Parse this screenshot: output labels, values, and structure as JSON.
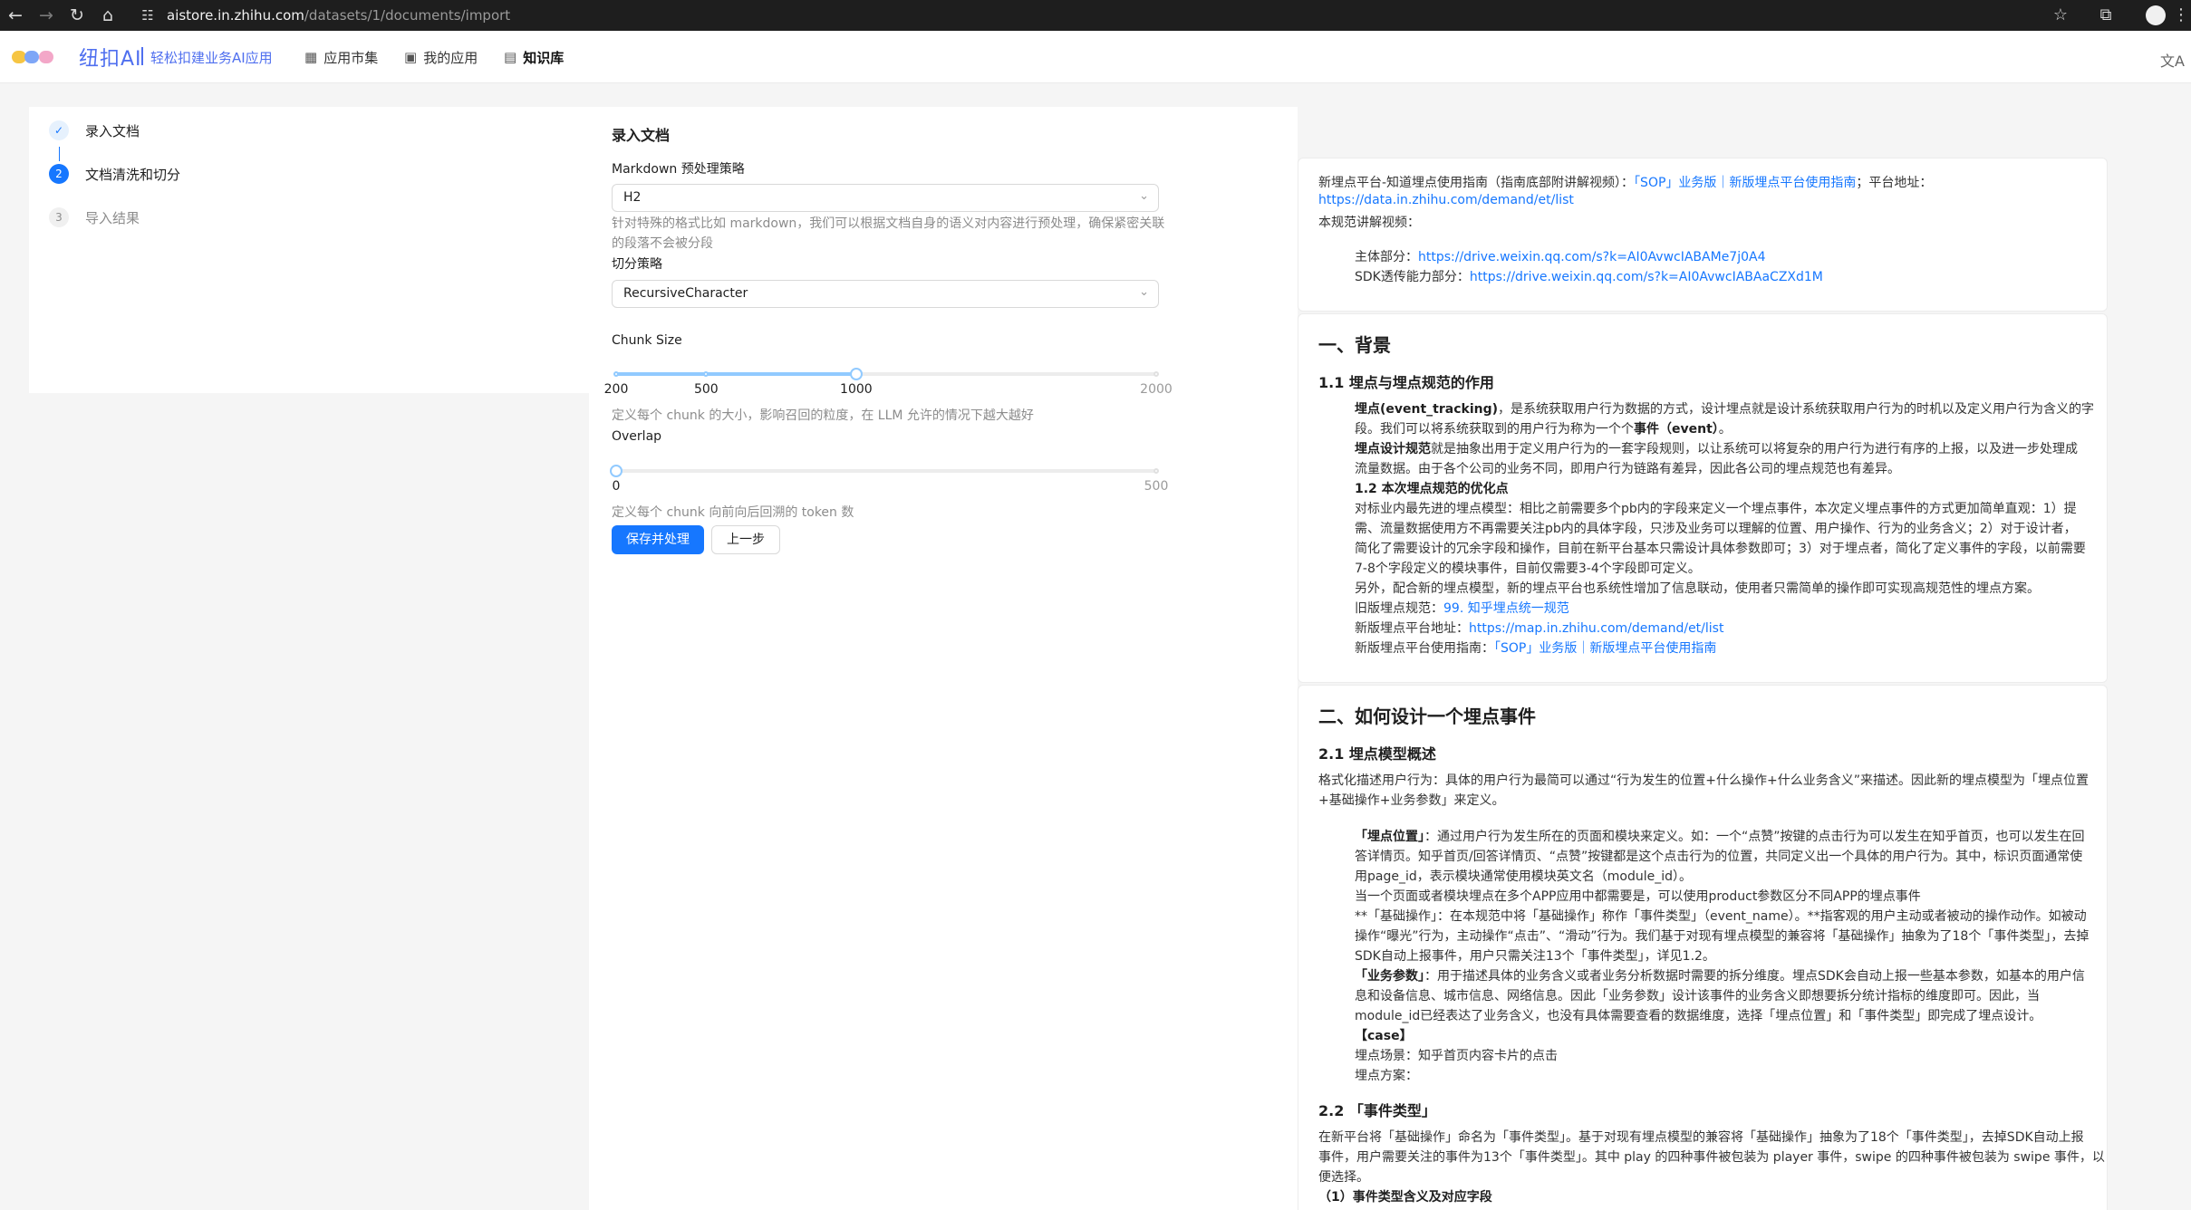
{
  "browser": {
    "url_host": "aistore.in.zhihu.com",
    "url_path": "/datasets/1/documents/import"
  },
  "header": {
    "brand": "纽扣AI",
    "tagline": "轻松扣建业务AI应用",
    "nav": [
      {
        "label": "应用市集",
        "icon": "grid-icon"
      },
      {
        "label": "我的应用",
        "icon": "apps-icon"
      },
      {
        "label": "知识库",
        "icon": "book-icon"
      }
    ],
    "logo_colors": [
      "#f6c543",
      "#7ea6f7",
      "#f3a7c8"
    ]
  },
  "steps": [
    {
      "index": "✓",
      "label": "录入文档",
      "state": "done"
    },
    {
      "index": "2",
      "label": "文档清洗和切分",
      "state": "active"
    },
    {
      "index": "3",
      "label": "导入结果",
      "state": "pending"
    }
  ],
  "form": {
    "title": "录入文档",
    "markdown_label": "Markdown 预处理策略",
    "markdown_value": "H2",
    "markdown_help_1": "针对特殊的格式比如 markdown，我们可以根据文档自身的语义对内容进行预处理，确保紧密关联",
    "markdown_help_2": "的段落不会被分段",
    "split_label": "切分策略",
    "split_value": "RecursiveCharacter",
    "chunk_label": "Chunk Size",
    "chunk_value": 1000,
    "chunk_min": 200,
    "chunk_max": 2000,
    "chunk_marks": [
      "200",
      "500",
      "1000",
      "2000"
    ],
    "chunk_help": "定义每个 chunk 的大小，影响召回的粒度，在 LLM 允许的情况下越大越好",
    "overlap_label": "Overlap",
    "overlap_value": 0,
    "overlap_min": 0,
    "overlap_max": 500,
    "overlap_marks": [
      "0",
      "500"
    ],
    "overlap_help": "定义每个 chunk 向前向后回溯的 token 数",
    "save_button": "保存并处理",
    "prev_button": "上一步"
  },
  "preview": {
    "c1": {
      "l1a": "新埋点平台-知道埋点使用指南（指南底部附讲解视频）：",
      "l1b": "「SOP」业务版｜新版埋点平台使用指南",
      "l1c": "；平台地址：",
      "l2": "https://data.in.zhihu.com/demand/et/list",
      "l3": "本规范讲解视频：",
      "l4a": "主体部分：",
      "l4b": "https://drive.weixin.qq.com/s?k=AI0AvwcIABAMe7j0A4",
      "l5a": "SDK透传能力部分：",
      "l5b": "https://drive.weixin.qq.com/s?k=AI0AvwcIABAaCZXd1M"
    },
    "c2": {
      "h1": "一、背景",
      "h2": "1.1 埋点与埋点规范的作用",
      "p1a": "埋点(event_tracking)",
      "p1b": "，是系统获取用户行为数据的方式，设计埋点就是设计系统获取用户行为的时机以及定义用户行为含义的字",
      "p2a": "段。我们可以将系统获取到的用户行为称为一个个",
      "p2b": "事件（event）",
      "p2c": "。",
      "p3a": "埋点设计规范",
      "p3b": "就是抽象出用于定义用户行为的一套字段规则，以让系统可以将复杂的用户行为进行有序的上报，以及进一步处理成",
      "p4": "流量数据。由于各个公司的业务不同，即用户行为链路有差异，因此各公司的埋点规范也有差异。",
      "h3": "1.2 本次埋点规范的优化点",
      "p5": "对标业内最先进的埋点模型：相比之前需要多个pb内的字段来定义一个埋点事件，本次定义埋点事件的方式更加简单直观：1）提",
      "p6": "需、流量数据使用方不再需要关注pb内的具体字段，只涉及业务可以理解的位置、用户操作、行为的业务含义；2）对于设计者，",
      "p7": "简化了需要设计的冗余字段和操作，目前在新平台基本只需设计具体参数即可；3）对于埋点者，简化了定义事件的字段，以前需要",
      "p8": "7-8个字段定义的模块事件，目前仅需要3-4个字段即可定义。",
      "p9": "另外，配合新的埋点模型，新的埋点平台也系统性增加了信息联动，使用者只需简单的操作即可实现高规范性的埋点方案。",
      "p10a": "旧版埋点规范：",
      "p10b": "99. 知乎埋点统一规范",
      "p11a": "新版埋点平台地址：",
      "p11b": "https://map.in.zhihu.com/demand/et/list",
      "p12a": "新版埋点平台使用指南：",
      "p12b": "「SOP」业务版｜新版埋点平台使用指南"
    },
    "c3": {
      "h1": "二、如何设计一个埋点事件",
      "h2": "2.1 埋点模型概述",
      "p1": "格式化描述用户行为：具体的用户行为最简可以通过“行为发生的位置+什么操作+什么业务含义”来描述。因此新的埋点模型为「埋点位置",
      "p2": "+基础操作+业务参数」来定义。",
      "p3a": "「埋点位置」",
      "p3b": "：通过用户行为发生所在的页面和模块来定义。如：一个“点赞”按键的点击行为可以发生在知乎首页，也可以发生在回",
      "p4": "答详情页。知乎首页/回答详情页、“点赞”按键都是这个点击行为的位置，共同定义出一个具体的用户行为。其中，标识页面通常使",
      "p5": "用page_id，表示模块通常使用模块英文名（module_id）。",
      "p6": "当一个页面或者模块埋点在多个APP应用中都需要是，可以使用product参数区分不同APP的埋点事件",
      "p7": "**「基础操作」：在本规范中将「基础操作」称作「事件类型」（event_name）。**指客观的用户主动或者被动的操作动作。如被动",
      "p8": "操作“曝光”行为，主动操作“点击”、“滑动”行为。我们基于对现有埋点模型的兼容将「基础操作」抽象为了18个「事件类型」，去掉",
      "p9": "SDK自动上报事件，用户只需关注13个「事件类型」，详见1.2。",
      "p10a": "「业务参数」",
      "p10b": "：用于描述具体的业务含义或者业务分析数据时需要的拆分维度。埋点SDK会自动上报一些基本参数，如基本的用户信",
      "p11": "息和设备信息、城市信息、网络信息。因此「业务参数」设计该事件的业务含义即想要拆分统计指标的维度即可。因此，当",
      "p12": "module_id已经表达了业务含义，也没有具体需要查看的数据维度，选择「埋点位置」和「事件类型」即完成了埋点设计。",
      "p13": "【case】",
      "p14": "埋点场景：知乎首页内容卡片的点击",
      "p15": "埋点方案：",
      "h3": "2.2 「事件类型」",
      "p16": "在新平台将「基础操作」命名为「事件类型」。基于对现有埋点模型的兼容将「基础操作」抽象为了18个「事件类型」，去掉SDK自动上报",
      "p17": "事件，用户需要关注的事件为13个「事件类型」。其中 play 的四种事件被包装为 player 事件，swipe 的四种事件被包装为 swipe 事件，以",
      "p18": "便选择。",
      "h4": "（1）事件类型含义及对应字段"
    }
  }
}
